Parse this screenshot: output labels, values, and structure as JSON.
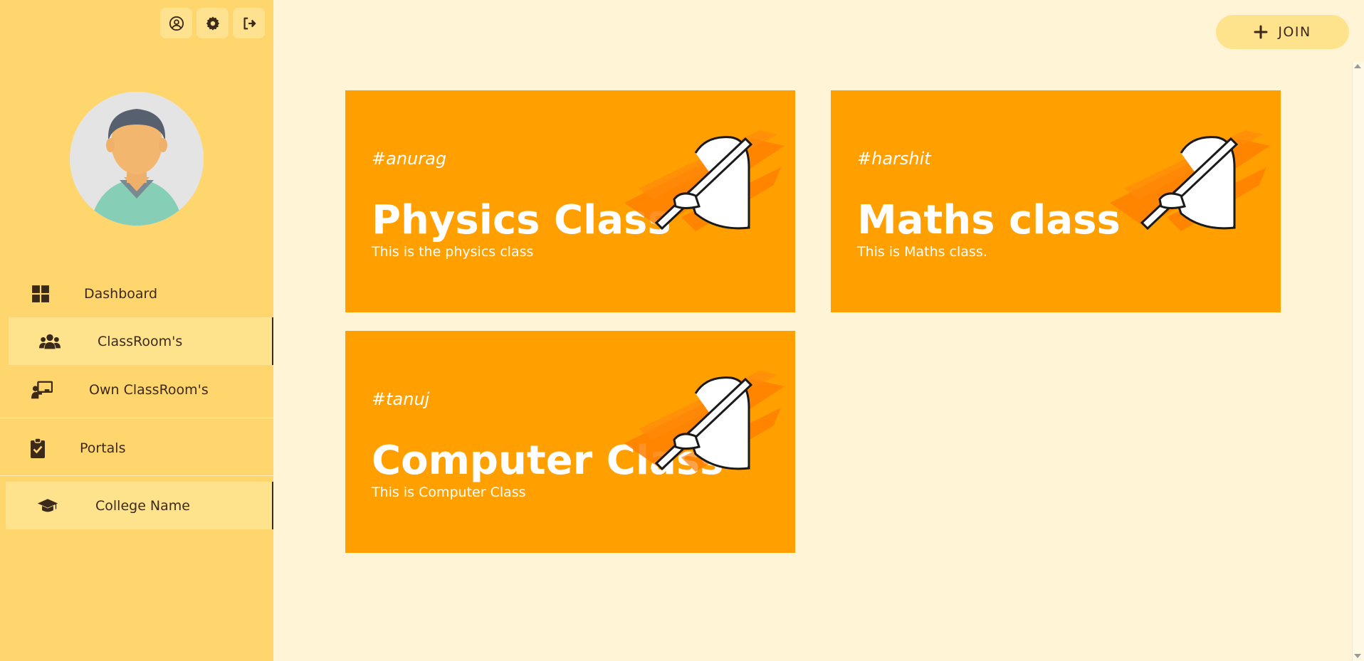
{
  "sidebar": {
    "top_icons": [
      "user-circle-icon",
      "gear-icon",
      "sign-out-icon"
    ],
    "nav": [
      {
        "label": "Dashboard",
        "icon": "dashboard-grid-icon"
      },
      {
        "label": "ClassRoom's",
        "icon": "users-group-icon",
        "active": true
      },
      {
        "label": "Own ClassRoom's",
        "icon": "chalkboard-teacher-icon"
      },
      {
        "label": "Portals",
        "icon": "clipboard-check-icon"
      },
      {
        "label": "College Name",
        "icon": "graduation-cap-icon",
        "active": true
      }
    ]
  },
  "header": {
    "join_label": "JOIN",
    "join_icon": "plus-icon"
  },
  "classes": [
    {
      "code": "#anurag",
      "title": "Physics Class",
      "description": "This is the physics class",
      "illustration": "pen-in-hand-icon"
    },
    {
      "code": "#harshit",
      "title": "Maths class",
      "description": "This is Maths class.",
      "illustration": "pen-in-hand-icon"
    },
    {
      "code": "#tanuj",
      "title": "Computer Class",
      "description": "This is Computer Class",
      "illustration": "pen-in-hand-icon"
    }
  ],
  "colors": {
    "sidebar_bg": "#ffd56e",
    "page_bg": "#fff4d6",
    "card_bg": "#ff9f00",
    "active_item_bg": "#ffe38c",
    "text_dark": "#3b2a1a"
  }
}
